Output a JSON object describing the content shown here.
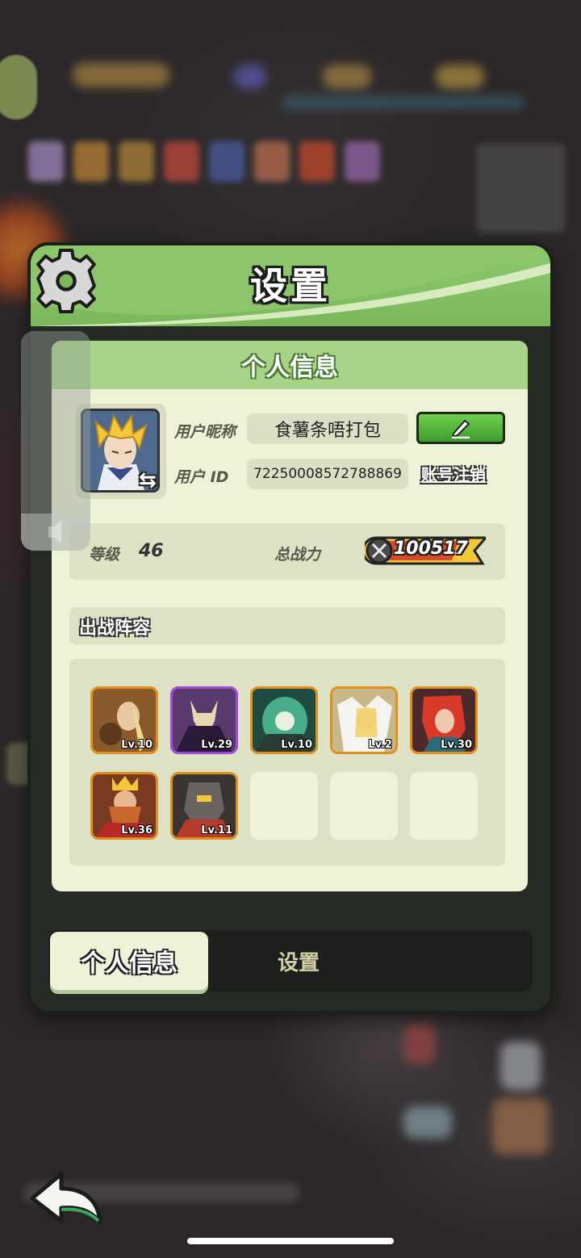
{
  "dialog": {
    "title": "设置",
    "panel_title": "个人信息"
  },
  "profile": {
    "nickname_label": "用户昵称",
    "nickname": "食薯条唔打包",
    "id_label": "用户 ID",
    "user_id": "72250008572788869",
    "delete_account": "账号注销",
    "level_label": "等级",
    "level": "46",
    "power_label": "总战力",
    "power": "100517"
  },
  "lineup": {
    "title": "出战阵容",
    "heroes": [
      {
        "level": "Lv.10",
        "rarity": "legend",
        "color": "#8a5a2a"
      },
      {
        "level": "Lv.29",
        "rarity": "epic",
        "color": "#5a3a6e"
      },
      {
        "level": "Lv.10",
        "rarity": "legend",
        "color": "#2f6a58"
      },
      {
        "level": "Lv.2",
        "rarity": "legend",
        "color": "#c9b98a"
      },
      {
        "level": "Lv.30",
        "rarity": "legend",
        "color": "#8a2f2a"
      },
      {
        "level": "Lv.36",
        "rarity": "legend",
        "color": "#7a3a22"
      },
      {
        "level": "Lv.11",
        "rarity": "legend",
        "color": "#3a3430"
      }
    ],
    "empty_slots": 3
  },
  "tabs": {
    "active": "个人信息",
    "other": "设置"
  },
  "colors": {
    "header_green": "#7ab85a",
    "panel_bg": "#eef3d8",
    "legend_border": "#e0901e",
    "epic_border": "#a44ad8"
  }
}
